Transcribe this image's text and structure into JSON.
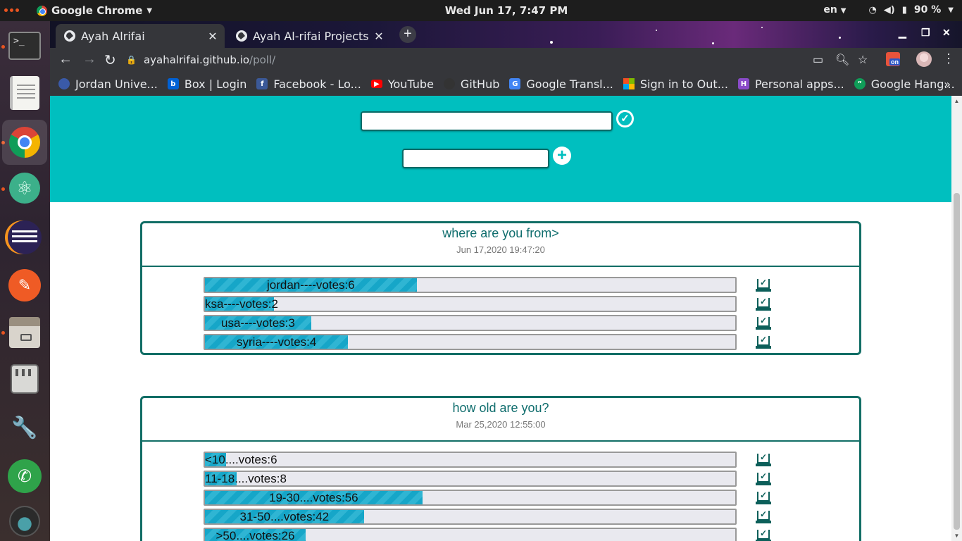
{
  "system_bar": {
    "app_name": "Google Chrome",
    "clock": "Wed Jun 17,  7:47 PM",
    "language": "en",
    "battery": "90 %"
  },
  "dock": {
    "items": [
      "terminal-icon",
      "text-editor-icon",
      "chrome-icon",
      "atom-icon",
      "eclipse-icon",
      "postman-icon",
      "files-icon",
      "mixer-icon",
      "settings-icon",
      "phone-icon",
      "avatar-icon"
    ]
  },
  "browser": {
    "tabs": [
      {
        "title": "Ayah Alrifai",
        "active": true
      },
      {
        "title": "Ayah Al-rifai Projects",
        "active": false
      }
    ],
    "url_host": "ayahalrifai.github.io",
    "url_path": "/poll/",
    "bookmarks": [
      {
        "label": "Jordan Unive...",
        "icon": "university-icon",
        "color": "#3a5aa8"
      },
      {
        "label": "Box | Login",
        "icon": "box-icon",
        "color": "#0061d5"
      },
      {
        "label": "Facebook - Lo...",
        "icon": "facebook-icon",
        "color": "#3b5998"
      },
      {
        "label": "YouTube",
        "icon": "youtube-icon",
        "color": "#ff0000"
      },
      {
        "label": "GitHub",
        "icon": "github-icon",
        "color": "#333333"
      },
      {
        "label": "Google Transl...",
        "icon": "translate-icon",
        "color": "#4285f4"
      },
      {
        "label": "Sign in to Out...",
        "icon": "microsoft-icon",
        "color": "#f25022"
      },
      {
        "label": "Personal apps...",
        "icon": "heroku-icon",
        "color": "#8a4bc9"
      },
      {
        "label": "Google Hang...",
        "icon": "hangouts-icon",
        "color": "#0f9d58"
      }
    ]
  },
  "colors": {
    "hero": "#00bfbf",
    "border": "#126e66",
    "bar_fill": "#16a6c8"
  },
  "polls": [
    {
      "question": "where are you from>",
      "date": "Jun 17,2020 19:47:20",
      "options": [
        {
          "label": "jordan----votes:6",
          "share": 0.4
        },
        {
          "label": "ksa----votes:2",
          "share": 0.13
        },
        {
          "label": "usa----votes:3",
          "share": 0.2
        },
        {
          "label": "syria----votes:4",
          "share": 0.27
        }
      ]
    },
    {
      "question": "how old are you?",
      "date": "Mar 25,2020 12:55:00",
      "options": [
        {
          "label": "<10....votes:6",
          "share": 0.04
        },
        {
          "label": "11-18....votes:8",
          "share": 0.06
        },
        {
          "label": "19-30....votes:56",
          "share": 0.41
        },
        {
          "label": "31-50....votes:42",
          "share": 0.3
        },
        {
          "label": ">50....votes:26",
          "share": 0.19
        }
      ]
    }
  ]
}
